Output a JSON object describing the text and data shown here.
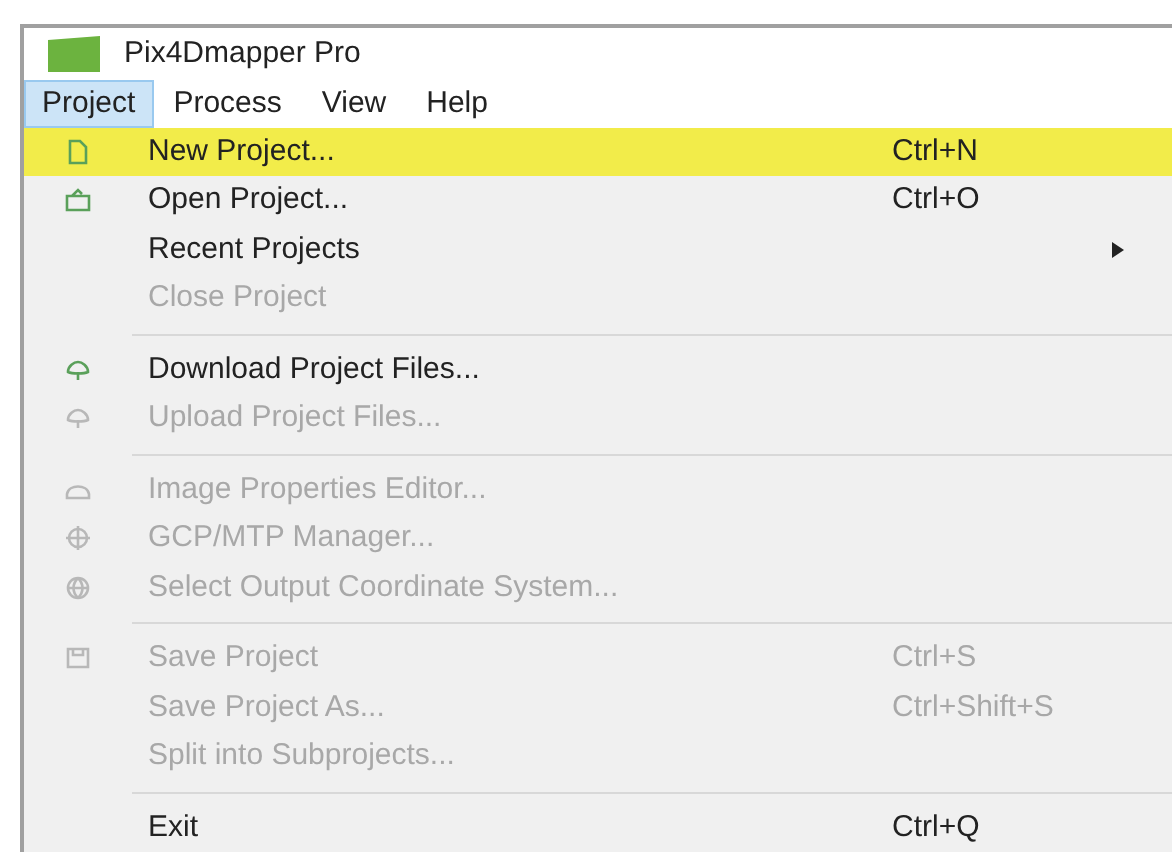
{
  "window": {
    "title": "Pix4Dmapper Pro"
  },
  "menubar": [
    {
      "label": "Project",
      "selected": true
    },
    {
      "label": "Process",
      "selected": false
    },
    {
      "label": "View",
      "selected": false
    },
    {
      "label": "Help",
      "selected": false
    }
  ],
  "menu": [
    {
      "kind": "item",
      "label": "New Project...",
      "shortcut": "Ctrl+N",
      "selected": true,
      "disabled": false,
      "submenu": false
    },
    {
      "kind": "item",
      "label": "Open Project...",
      "shortcut": "Ctrl+O",
      "selected": false,
      "disabled": false,
      "submenu": false
    },
    {
      "kind": "item",
      "label": "Recent Projects",
      "selected": false,
      "disabled": false,
      "submenu": true
    },
    {
      "kind": "item",
      "label": "Close Project",
      "selected": false,
      "disabled": true,
      "submenu": false
    },
    {
      "kind": "separator"
    },
    {
      "kind": "item",
      "label": "Download Project Files...",
      "selected": false,
      "disabled": false,
      "submenu": false
    },
    {
      "kind": "item",
      "label": "Upload Project Files...",
      "selected": false,
      "disabled": true,
      "submenu": false
    },
    {
      "kind": "separator"
    },
    {
      "kind": "item",
      "label": "Image Properties Editor...",
      "selected": false,
      "disabled": true,
      "submenu": false
    },
    {
      "kind": "item",
      "label": "GCP/MTP Manager...",
      "selected": false,
      "disabled": true,
      "submenu": false
    },
    {
      "kind": "item",
      "label": "Select Output Coordinate System...",
      "selected": false,
      "disabled": true,
      "submenu": false
    },
    {
      "kind": "separator"
    },
    {
      "kind": "item",
      "label": "Save Project",
      "shortcut": "Ctrl+S",
      "selected": false,
      "disabled": true,
      "submenu": false
    },
    {
      "kind": "item",
      "label": "Save Project As...",
      "shortcut": "Ctrl+Shift+S",
      "selected": false,
      "disabled": true,
      "submenu": false
    },
    {
      "kind": "item",
      "label": "Split into Subprojects...",
      "selected": false,
      "disabled": true,
      "submenu": false
    },
    {
      "kind": "separator"
    },
    {
      "kind": "item",
      "label": "Exit",
      "shortcut": "Ctrl+Q",
      "selected": false,
      "disabled": false,
      "submenu": false
    }
  ]
}
